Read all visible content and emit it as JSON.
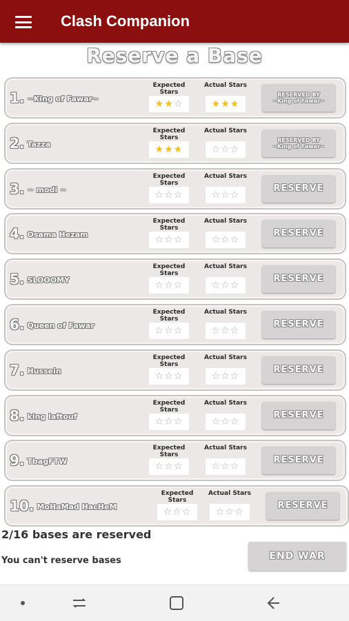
{
  "app_bar": {
    "title": "Clash Companion",
    "menu_icon": "hamburger-menu-icon",
    "color": "#8b0f0f"
  },
  "page": {
    "heading": "Reserve a Base"
  },
  "labels": {
    "expected": "Expected Stars",
    "actual": "Actual Stars"
  },
  "bases": [
    {
      "num": "1.",
      "name": "~King of Fawar~",
      "expected_stars": 2,
      "actual_stars": 3,
      "button": "RESERVED BY ~King of Fawar~",
      "reserved": true
    },
    {
      "num": "2.",
      "name": "Tazza",
      "expected_stars": 3,
      "actual_stars": 0,
      "button": "RESERVED BY ~King of Fawar~",
      "reserved": true
    },
    {
      "num": "3.",
      "name": "~ modi ~",
      "expected_stars": 0,
      "actual_stars": 0,
      "button": "RESERVE",
      "reserved": false
    },
    {
      "num": "4.",
      "name": "Osama Hezam",
      "expected_stars": 0,
      "actual_stars": 0,
      "button": "RESERVE",
      "reserved": false
    },
    {
      "num": "5.",
      "name": "SLOOOMY",
      "expected_stars": 0,
      "actual_stars": 0,
      "button": "RESERVE",
      "reserved": false
    },
    {
      "num": "6.",
      "name": "Queen of Fawar",
      "expected_stars": 0,
      "actual_stars": 0,
      "button": "RESERVE",
      "reserved": false
    },
    {
      "num": "7.",
      "name": "Hussein",
      "expected_stars": 0,
      "actual_stars": 0,
      "button": "RESERVE",
      "reserved": false
    },
    {
      "num": "8.",
      "name": "king laftouf",
      "expected_stars": 0,
      "actual_stars": 0,
      "button": "RESERVE",
      "reserved": false
    },
    {
      "num": "9.",
      "name": "TbagFTW",
      "expected_stars": 0,
      "actual_stars": 0,
      "button": "RESERVE",
      "reserved": false
    },
    {
      "num": "10.",
      "name": "MoHaMad HacHeM",
      "expected_stars": 0,
      "actual_stars": 0,
      "button": "RESERVE",
      "reserved": false
    }
  ],
  "summary": {
    "reserved_text": "2/16 bases are reserved",
    "notice": "You can't reserve bases",
    "end_war_label": "END WAR"
  },
  "colors": {
    "star_on": "#f2bd1d",
    "star_off": "#b0b0b0"
  },
  "navbar": {
    "icons": [
      "dot-icon",
      "recent-apps-icon",
      "home-icon",
      "back-icon"
    ]
  }
}
